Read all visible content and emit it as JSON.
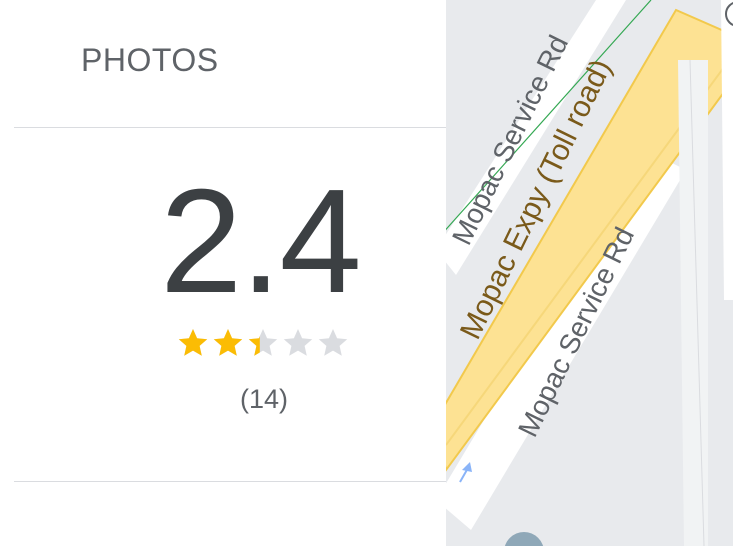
{
  "panel": {
    "photos_tab": "PHOTOS",
    "rating": {
      "value": "2.4",
      "count": "(14)",
      "stars_filled": 2.4,
      "stars_total": 5
    }
  },
  "map": {
    "labels": {
      "service_rd_upper": "Mopac Service Rd",
      "toll_road": "Mopac Expy (Toll road)",
      "service_rd_lower": "Mopac Service Rd"
    }
  },
  "colors": {
    "star_filled": "#fbbc04",
    "star_empty": "#dadce0",
    "map_background": "#e8eaed",
    "toll_road": "#fde293",
    "service_road": "#ffffff",
    "text_primary": "#3c4043",
    "text_secondary": "#5f6368"
  },
  "icons": [
    "star-icon",
    "half-star-icon",
    "location-pin-icon",
    "direction-arrow-icon"
  ]
}
